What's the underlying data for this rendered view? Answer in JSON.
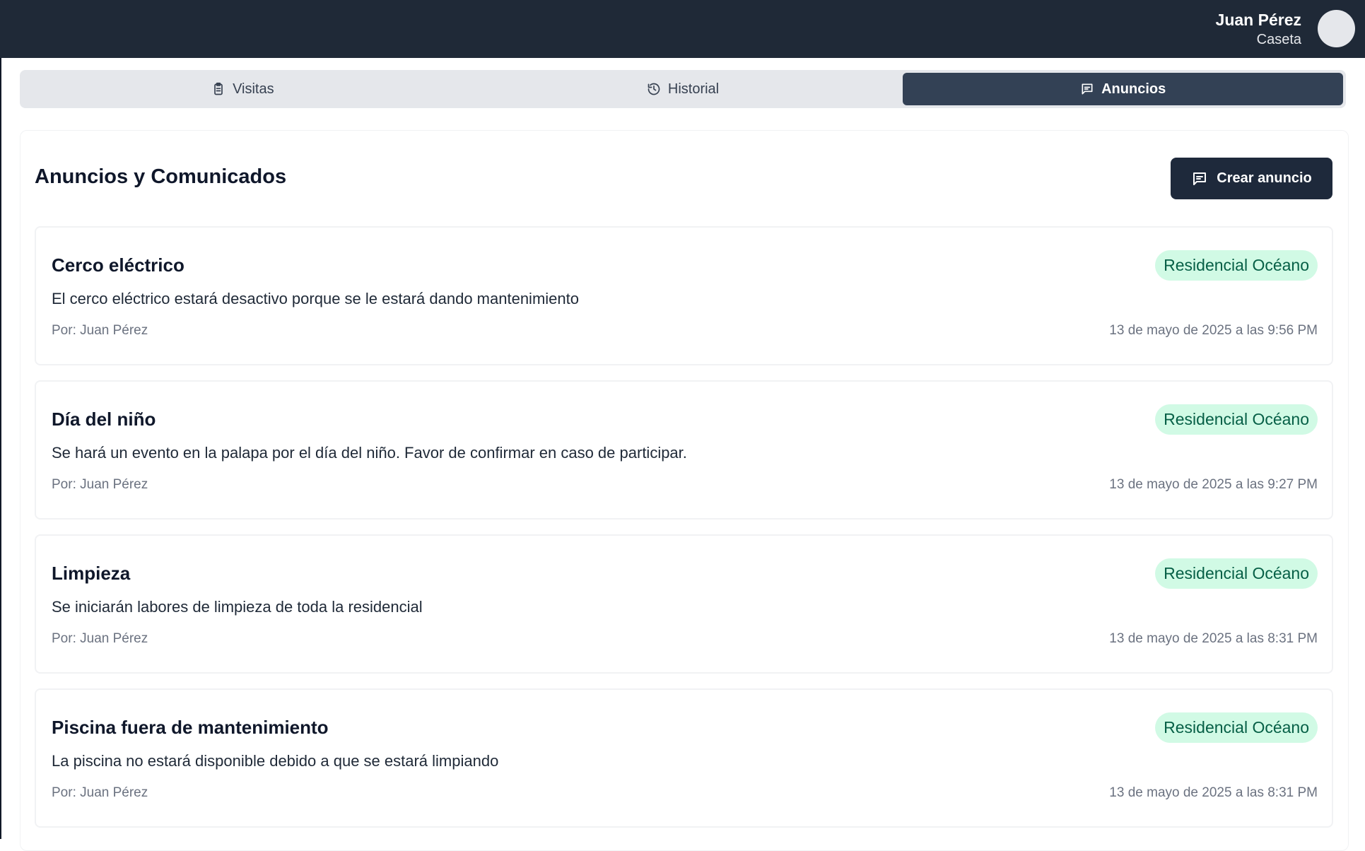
{
  "user": {
    "name": "Juan Pérez",
    "role": "Caseta"
  },
  "tabs": [
    {
      "label": "Visitas",
      "icon": "clipboard-icon",
      "active": false
    },
    {
      "label": "Historial",
      "icon": "history-icon",
      "active": false
    },
    {
      "label": "Anuncios",
      "icon": "message-icon",
      "active": true
    }
  ],
  "panel": {
    "title": "Anuncios y Comunicados",
    "create_label": "Crear anuncio"
  },
  "announcements": [
    {
      "title": "Cerco eléctrico",
      "badge": "Residencial Océano",
      "body": "El cerco eléctrico estará desactivo porque se le estará dando mantenimiento",
      "author": "Por: Juan Pérez",
      "date": "13 de mayo de 2025 a las 9:56 PM"
    },
    {
      "title": "Día del niño",
      "badge": "Residencial Océano",
      "body": "Se hará un evento en la palapa por el día del niño. Favor de confirmar en caso de participar.",
      "author": "Por: Juan Pérez",
      "date": "13 de mayo de 2025 a las 9:27 PM"
    },
    {
      "title": "Limpieza",
      "badge": "Residencial Océano",
      "body": "Se iniciarán labores de limpieza de toda la residencial",
      "author": "Por: Juan Pérez",
      "date": "13 de mayo de 2025 a las 8:31 PM"
    },
    {
      "title": "Piscina fuera de mantenimiento",
      "badge": "Residencial Océano",
      "body": "La piscina no estará disponible debido a que se estará limpiando",
      "author": "Por: Juan Pérez",
      "date": "13 de mayo de 2025 a las 8:31 PM"
    }
  ],
  "colors": {
    "topbar": "#1f2937",
    "active_tab": "#334155",
    "button": "#1e293b",
    "badge_bg": "#d1fae5",
    "badge_text": "#065f46"
  }
}
